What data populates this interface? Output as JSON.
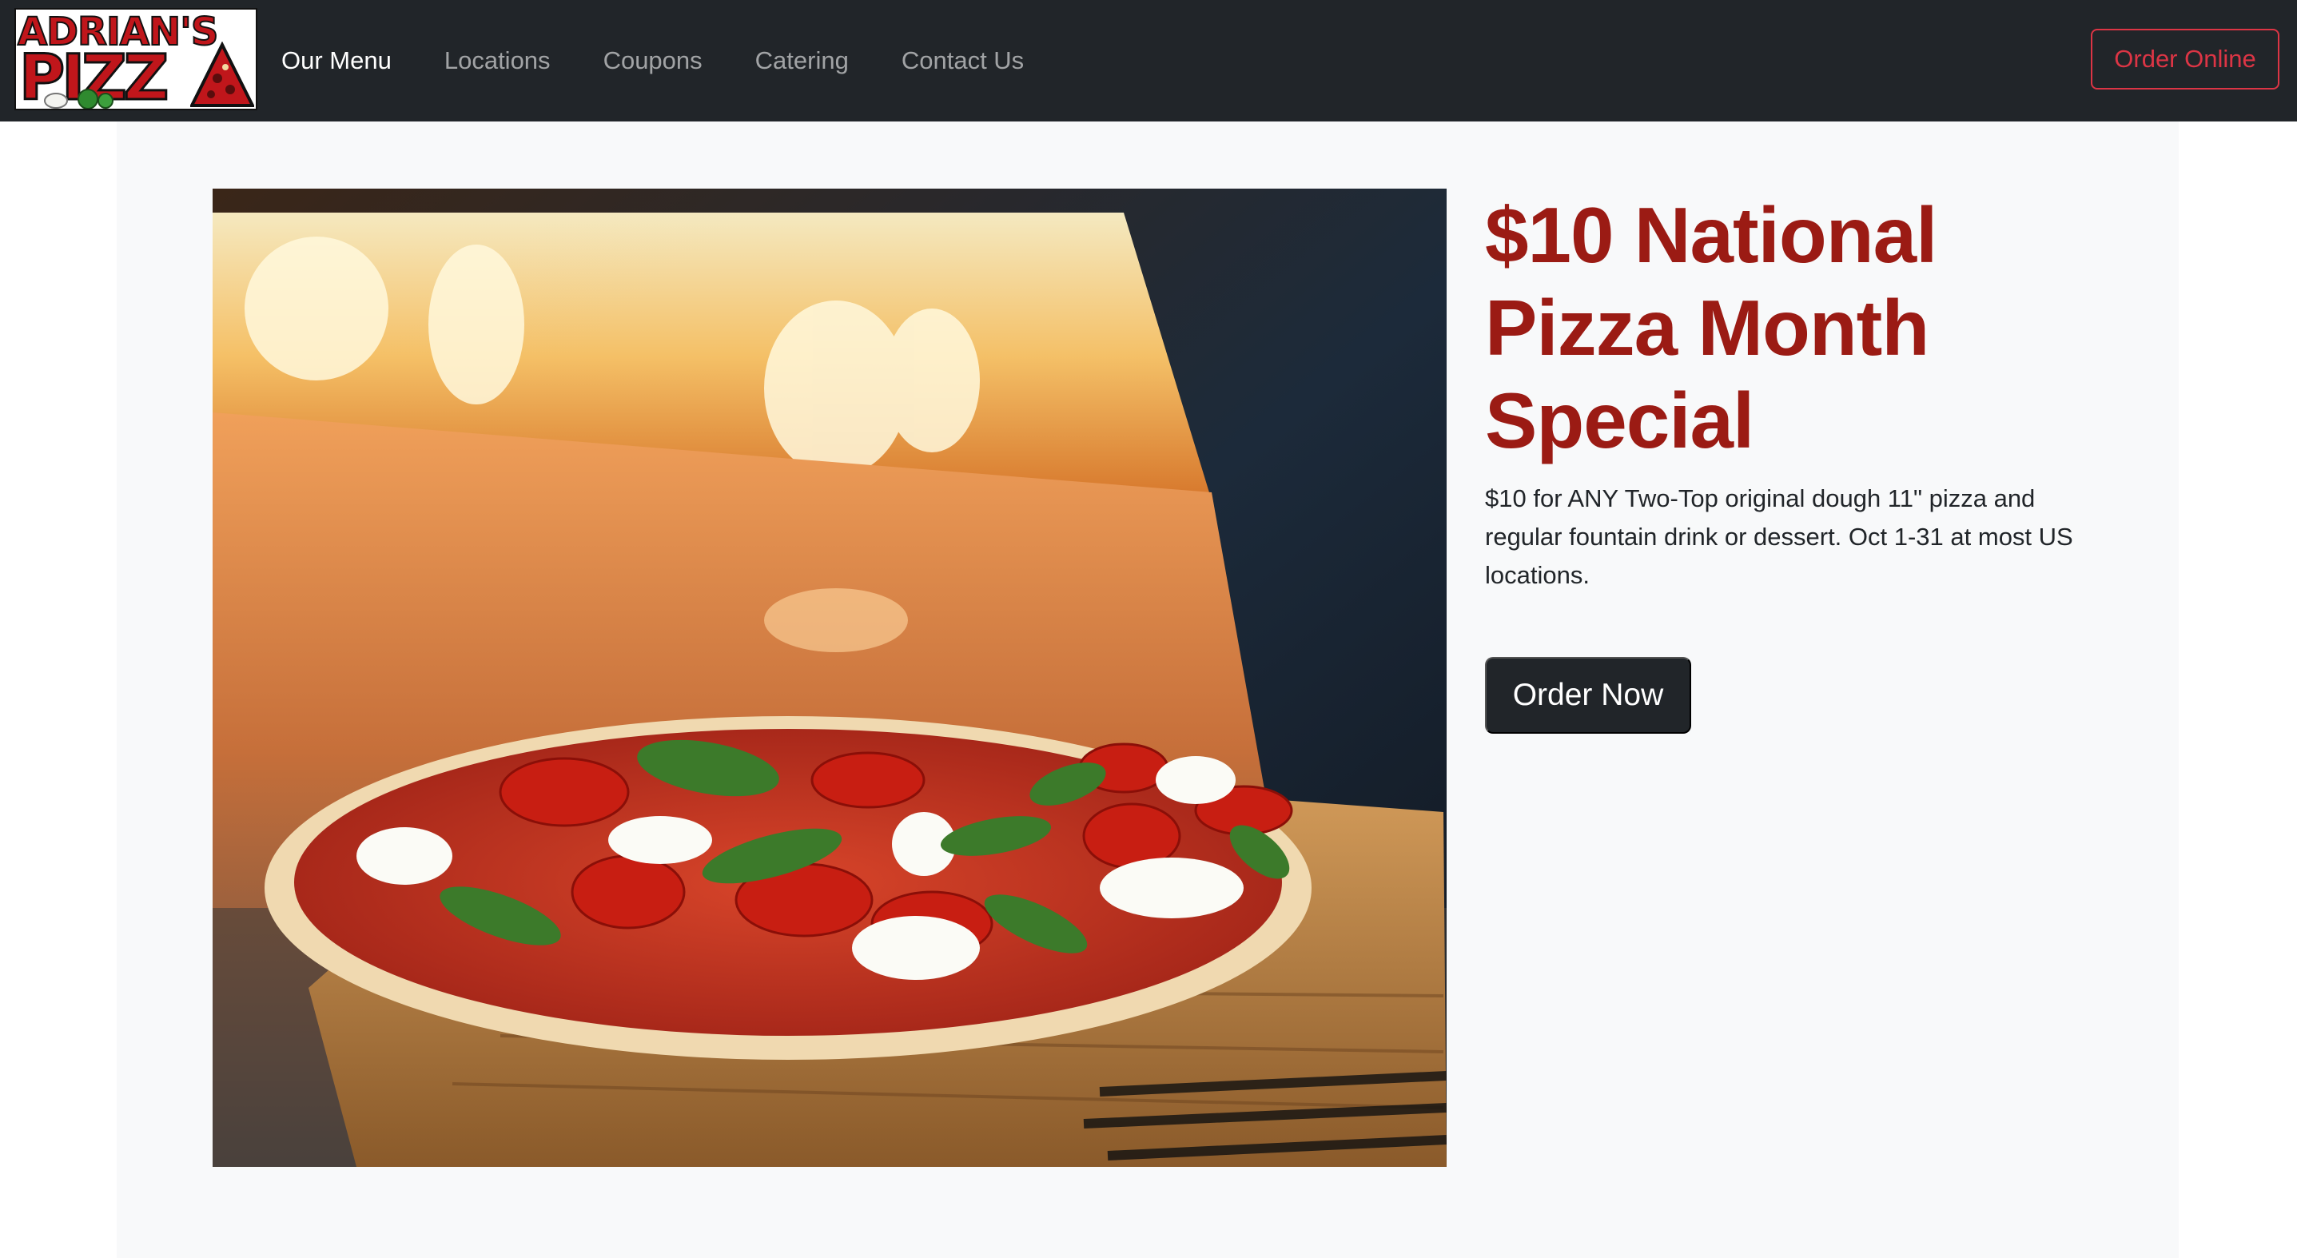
{
  "brand": {
    "line1": "ADRIAN'S",
    "line2": "PIZZ"
  },
  "nav": {
    "items": [
      {
        "label": "Our Menu",
        "active": true
      },
      {
        "label": "Locations",
        "active": false
      },
      {
        "label": "Coupons",
        "active": false
      },
      {
        "label": "Catering",
        "active": false
      },
      {
        "label": "Contact Us",
        "active": false
      }
    ],
    "order_online": "Order Online"
  },
  "hero": {
    "title": "$10 National Pizza Month Special",
    "description": "$10 for ANY Two-Top original dough 11\" pizza and regular fountain drink or dessert. Oct 1-31 at most US locations.",
    "cta": "Order Now"
  },
  "colors": {
    "navbar_bg": "#212529",
    "accent_red": "#dc3545",
    "title_red": "#9b1b14",
    "hero_bg": "#f8f9fa"
  }
}
